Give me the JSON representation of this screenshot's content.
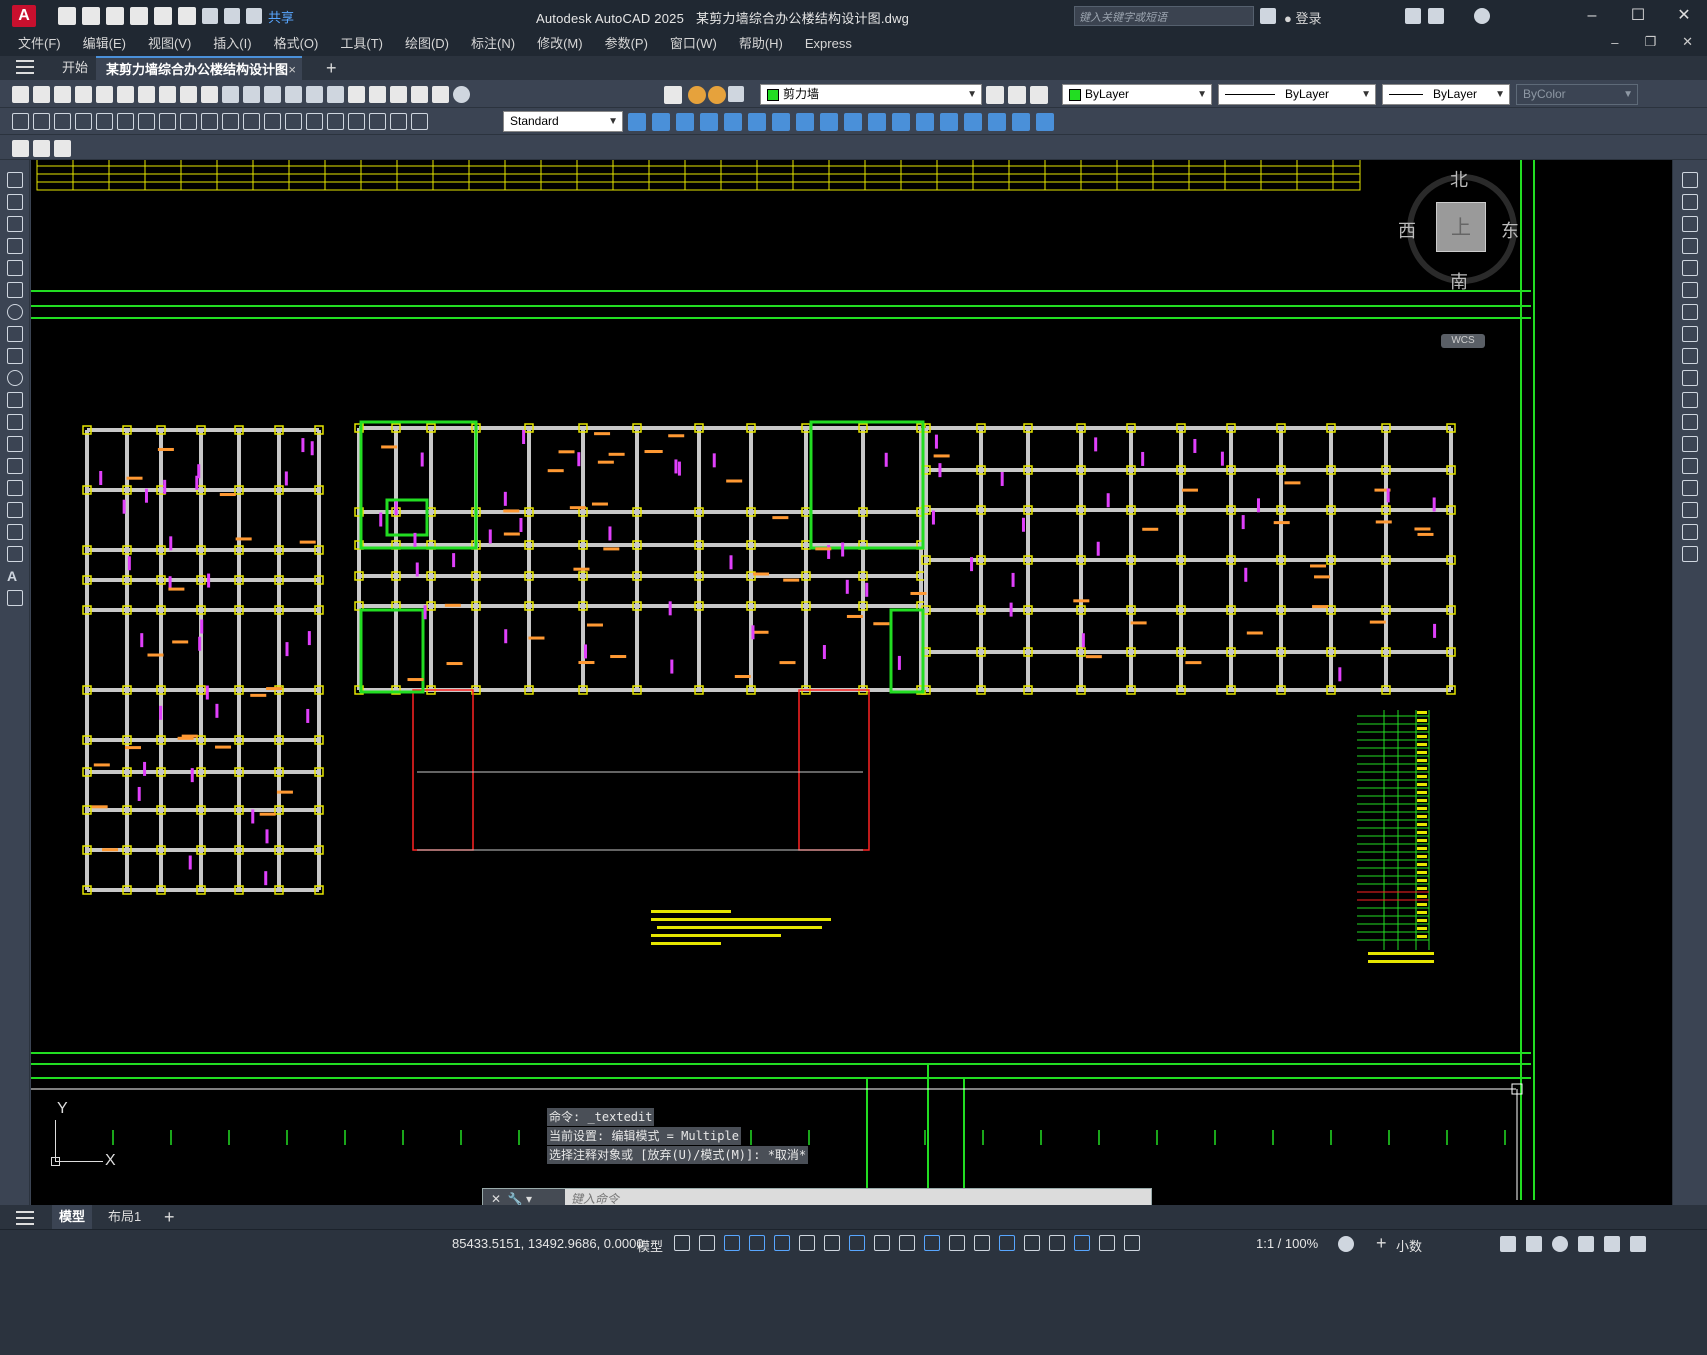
{
  "app": {
    "logo_letter": "A",
    "title": "Autodesk AutoCAD 2025",
    "document": "某剪力墙综合办公楼结构设计图.dwg",
    "share_label": "共享",
    "search_placeholder": "键入关键字或短语",
    "login_label": "登录"
  },
  "menu": [
    "文件(F)",
    "编辑(E)",
    "视图(V)",
    "插入(I)",
    "格式(O)",
    "工具(T)",
    "绘图(D)",
    "标注(N)",
    "修改(M)",
    "参数(P)",
    "窗口(W)",
    "帮助(H)",
    "Express"
  ],
  "tabs": {
    "start": "开始",
    "document": "某剪力墙综合办公楼结构设计图*",
    "close": "×",
    "new": "+"
  },
  "properties": {
    "layer": "剪力墙",
    "layer_color": "#22dd22",
    "color": "ByLayer",
    "linetype": "ByLayer",
    "lineweight": "ByLayer",
    "plotstyle": "ByColor",
    "text_style": "Standard"
  },
  "viewcube": {
    "north": "北",
    "south": "南",
    "east": "东",
    "west": "西",
    "face": "上",
    "ucs": "WCS"
  },
  "ucs_icon": {
    "y": "Y",
    "x": "X"
  },
  "command": {
    "history": [
      "命令: _textedit",
      "当前设置: 编辑模式 = Multiple",
      "选择注释对象或 [放弃(U)/模式(M)]: *取消*"
    ],
    "placeholder": "键入命令"
  },
  "layouts": [
    "模型",
    "布局1"
  ],
  "layout_add": "+",
  "status": {
    "coordinates": "85433.5151, 13492.9686, 0.0000",
    "space": "模型",
    "annotation_scale": "1:1 / 100%",
    "units": "小数"
  },
  "colors": {
    "wall_green": "#22dd22",
    "grid_yellow": "#e6e600",
    "label_magenta": "#e040fb",
    "label_orange": "#ff9933",
    "red": "#ff2222",
    "accent_blue": "#4a90d9"
  }
}
